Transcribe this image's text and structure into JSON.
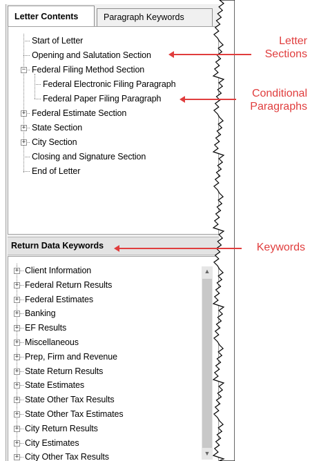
{
  "tabs": [
    {
      "label": "Letter Contents",
      "active": true
    },
    {
      "label": "Paragraph Keywords",
      "active": false
    }
  ],
  "letter_tree": [
    {
      "label": "Start of Letter",
      "level": 0,
      "expander": "none"
    },
    {
      "label": "Opening and Salutation Section",
      "level": 0,
      "expander": "none"
    },
    {
      "label": "Federal Filing Method Section",
      "level": 0,
      "expander": "minus"
    },
    {
      "label": "Federal Electronic Filing Paragraph",
      "level": 1,
      "expander": "none"
    },
    {
      "label": "Federal Paper Filing Paragraph",
      "level": 1,
      "expander": "none"
    },
    {
      "label": "Federal Estimate Section",
      "level": 0,
      "expander": "plus"
    },
    {
      "label": "State Section",
      "level": 0,
      "expander": "plus"
    },
    {
      "label": "City Section",
      "level": 0,
      "expander": "plus"
    },
    {
      "label": "Closing and Signature Section",
      "level": 0,
      "expander": "none"
    },
    {
      "label": "End of Letter",
      "level": 0,
      "expander": "none"
    }
  ],
  "keywords_header": "Return Data Keywords",
  "keyword_tree": [
    "Client Information",
    "Federal Return Results",
    "Federal Estimates",
    "Banking",
    "EF Results",
    "Miscellaneous",
    "Prep, Firm and Revenue",
    "State Return Results",
    "State Estimates",
    "State Other Tax Results",
    "State Other Tax Estimates",
    "City Return Results",
    "City Estimates",
    "City Other Tax Results"
  ],
  "callouts": {
    "letter_sections": [
      "Letter",
      "Sections"
    ],
    "conditional_paragraphs": [
      "Conditional",
      "Paragraphs"
    ],
    "keywords": "Keywords"
  },
  "colors": {
    "callout": "#e03d3d",
    "tree_line": "#808080",
    "header_bg": "#e3e3e3"
  }
}
